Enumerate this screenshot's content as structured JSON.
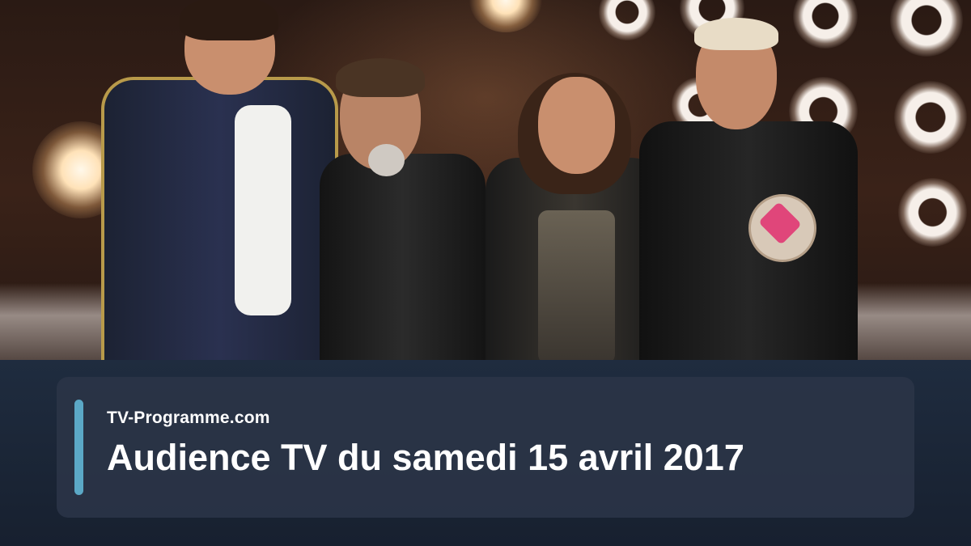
{
  "caption": {
    "brand": "TV-Programme.com",
    "headline": "Audience TV du samedi 15 avril 2017"
  },
  "colors": {
    "accent": "#5ba8c6",
    "card": "#2a3446",
    "text": "#ffffff"
  },
  "photo": {
    "subject": "four-people-on-stage"
  }
}
